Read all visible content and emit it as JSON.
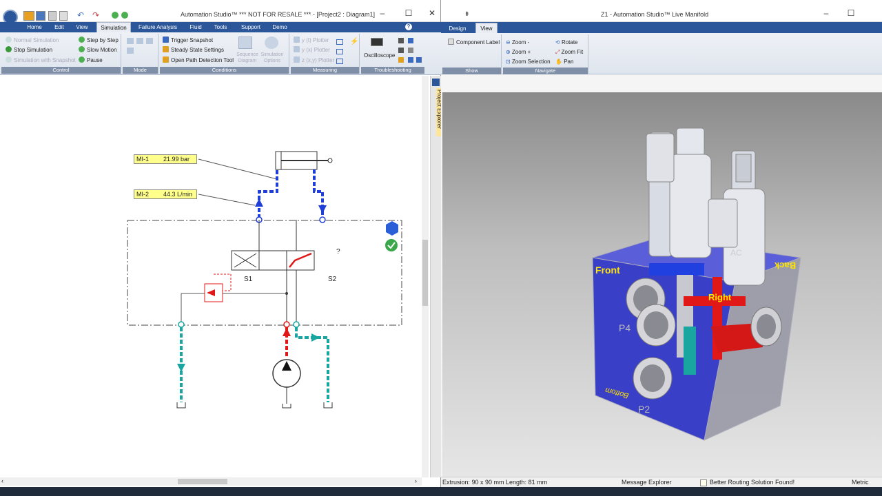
{
  "left_window": {
    "title": "Automation Studio™  *** NOT FOR RESALE ***   - [Project2 : Diagram1]",
    "menu": [
      "Home",
      "Edit",
      "View",
      "Simulation",
      "Failure Analysis",
      "Fluid",
      "Tools",
      "Support",
      "Demo"
    ],
    "active_menu": "Simulation",
    "ribbon": {
      "control": {
        "label": "Control",
        "items": [
          "Normal Simulation",
          "Stop Simulation",
          "Simulation with Snapshot",
          "Step by Step",
          "Slow Motion",
          "Pause"
        ]
      },
      "mode": {
        "label": "Mode"
      },
      "conditions": {
        "label": "Conditions",
        "items": [
          "Trigger Snapshot",
          "Steady State Settings",
          "Open Path Detection Tool",
          "Sequence Diagram",
          "Simulation Options"
        ]
      },
      "measuring": {
        "label": "Measuring",
        "items": [
          "y (t) Plotter",
          "y (x) Plotter",
          "z (x,y) Plotter"
        ]
      },
      "troubleshooting": {
        "label": "Troubleshooting",
        "items": [
          "Oscilloscope"
        ]
      }
    },
    "diagram": {
      "mi1": {
        "name": "MI-1",
        "value": "21.99 bar"
      },
      "mi2": {
        "name": "MI-2",
        "value": "44.3 L/min"
      },
      "s1": "S1",
      "s2": "S2",
      "question": "?"
    },
    "side_panel": "Project Explorer"
  },
  "right_window": {
    "title": "Z1 - Automation Studio™ Live Manifold",
    "tabs": [
      "Design",
      "View"
    ],
    "active_tab": "View",
    "ribbon": {
      "show": {
        "label": "Show",
        "items": [
          "Component Label"
        ]
      },
      "navigate": {
        "label": "Navigate",
        "items": [
          "Zoom -",
          "Zoom +",
          "Zoom Selection",
          "Rotate",
          "Zoom Fit",
          "Pan"
        ]
      }
    },
    "model_labels": {
      "front": "Front",
      "back": "Back",
      "right": "Right",
      "bottom": "Bottom",
      "p4": "P4",
      "p2": "P2",
      "ac": "AC"
    },
    "status": {
      "extrusion": "Extrusion: 90 x 90  mm  Length: 81  mm",
      "message_explorer": "Message Explorer",
      "routing": "Better Routing Solution Found!",
      "units": "Metric"
    }
  },
  "colors": {
    "menu_blue": "#2b579a",
    "pressure_red": "#e01818",
    "return_teal": "#1aa6a0",
    "pilot_blue": "#1f3fd6",
    "block_blue": "#3a3fc8"
  }
}
